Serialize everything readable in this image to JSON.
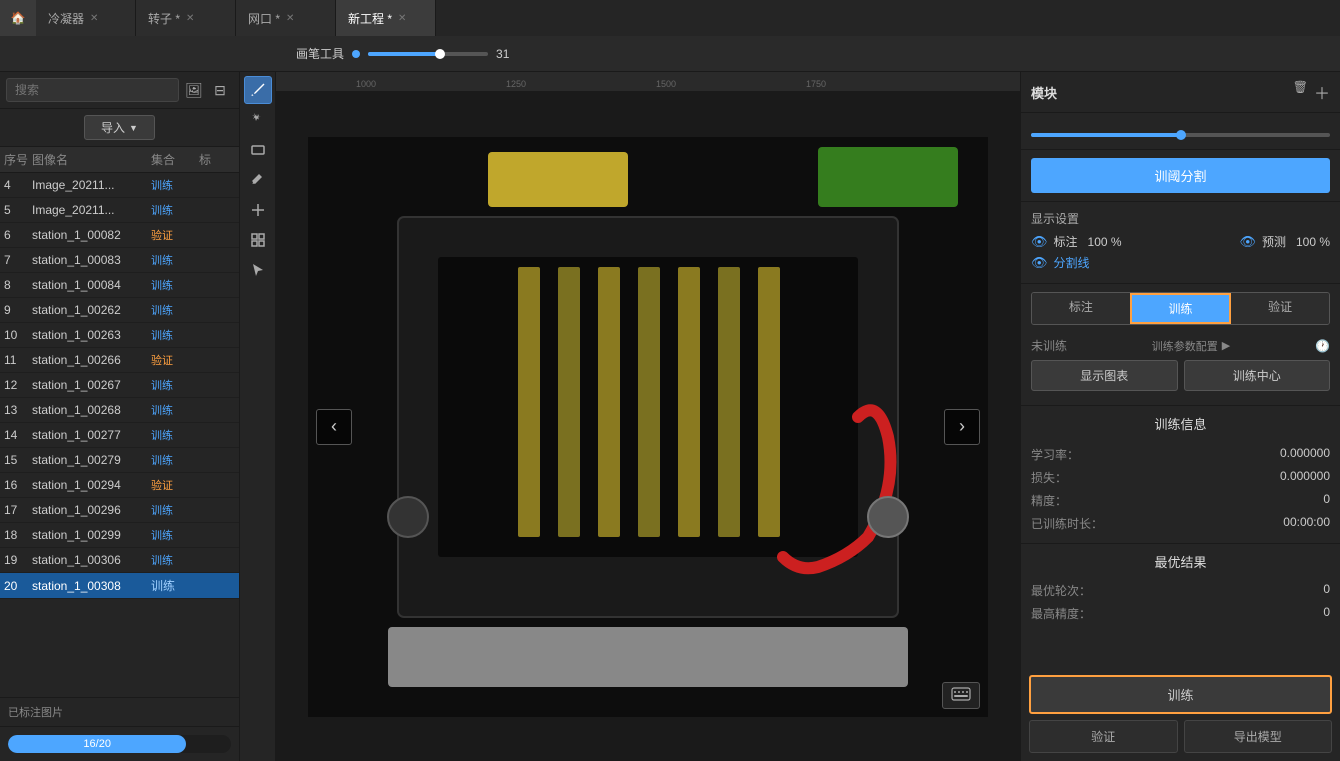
{
  "titlebar": {
    "tabs": [
      {
        "label": "冷凝器",
        "active": false,
        "modified": false
      },
      {
        "label": "转子 *",
        "active": false,
        "modified": true
      },
      {
        "label": "网口 *",
        "active": false,
        "modified": true
      },
      {
        "label": "新工程 *",
        "active": true,
        "modified": true
      }
    ]
  },
  "toolbar": {
    "tool_label": "画笔工具",
    "slider_value": "31"
  },
  "search": {
    "placeholder": "搜索"
  },
  "import_btn": "导入",
  "table": {
    "headers": [
      "序号",
      "图像名",
      "集合",
      "标"
    ],
    "rows": [
      {
        "id": "4",
        "name": "Image_20211...",
        "set": "训练",
        "tag": ""
      },
      {
        "id": "5",
        "name": "Image_20211...",
        "set": "训练",
        "tag": ""
      },
      {
        "id": "6",
        "name": "station_1_00082",
        "set": "验证",
        "tag": ""
      },
      {
        "id": "7",
        "name": "station_1_00083",
        "set": "训练",
        "tag": ""
      },
      {
        "id": "8",
        "name": "station_1_00084",
        "set": "训练",
        "tag": ""
      },
      {
        "id": "9",
        "name": "station_1_00262",
        "set": "训练",
        "tag": ""
      },
      {
        "id": "10",
        "name": "station_1_00263",
        "set": "训练",
        "tag": ""
      },
      {
        "id": "11",
        "name": "station_1_00266",
        "set": "验证",
        "tag": ""
      },
      {
        "id": "12",
        "name": "station_1_00267",
        "set": "训练",
        "tag": ""
      },
      {
        "id": "13",
        "name": "station_1_00268",
        "set": "训练",
        "tag": ""
      },
      {
        "id": "14",
        "name": "station_1_00277",
        "set": "训练",
        "tag": ""
      },
      {
        "id": "15",
        "name": "station_1_00279",
        "set": "训练",
        "tag": ""
      },
      {
        "id": "16",
        "name": "station_1_00294",
        "set": "验证",
        "tag": ""
      },
      {
        "id": "17",
        "name": "station_1_00296",
        "set": "训练",
        "tag": ""
      },
      {
        "id": "18",
        "name": "station_1_00299",
        "set": "训练",
        "tag": ""
      },
      {
        "id": "19",
        "name": "station_1_00306",
        "set": "训练",
        "tag": ""
      },
      {
        "id": "20",
        "name": "station_1_00308",
        "set": "训练",
        "tag": "",
        "selected": true
      }
    ]
  },
  "footer": {
    "label": "已标注图片",
    "progress": "16/20",
    "progress_pct": 80
  },
  "ruler": {
    "marks": [
      "1000",
      "1250",
      "1500",
      "1750"
    ]
  },
  "right_panel": {
    "title": "模块",
    "segment_btn": "训阈分割",
    "display": {
      "title": "显示设置",
      "label_pct": "100 %",
      "predict_pct": "100 %",
      "label_text": "标注",
      "predict_text": "预测",
      "seg_line": "分割线"
    },
    "tabs": [
      "标注",
      "训练",
      "验证"
    ],
    "active_tab": 1,
    "train_status": "未训练",
    "config_btn": "训练参数配置",
    "show_chart_btn": "显示图表",
    "train_center_btn": "训练中心",
    "train_info": {
      "title": "训练信息",
      "learning_rate_label": "学习率：",
      "learning_rate_val": "0.000000",
      "loss_label": "损失：",
      "loss_val": "0.000000",
      "accuracy_label": "精度：",
      "accuracy_val": "0",
      "trained_time_label": "已训练时长：",
      "trained_time_val": "00:00:00"
    },
    "best_results": {
      "title": "最优结果",
      "best_epoch_label": "最优轮次：",
      "best_epoch_val": "0",
      "best_accuracy_label": "最高精度：",
      "best_accuracy_val": "0"
    },
    "train_btn": "训练",
    "verify_btn": "验证",
    "export_btn": "导出模型"
  },
  "tools": [
    {
      "icon": "✏️",
      "name": "pen-tool",
      "active": true
    },
    {
      "icon": "✦",
      "name": "magic-tool",
      "active": false
    },
    {
      "icon": "⊡",
      "name": "rect-tool",
      "active": false
    },
    {
      "icon": "⌫",
      "name": "erase-tool",
      "active": false
    },
    {
      "icon": "✛",
      "name": "cross-tool",
      "active": false
    },
    {
      "icon": "⊞",
      "name": "grid-tool",
      "active": false
    },
    {
      "icon": "↖",
      "name": "select-tool",
      "active": false
    }
  ]
}
